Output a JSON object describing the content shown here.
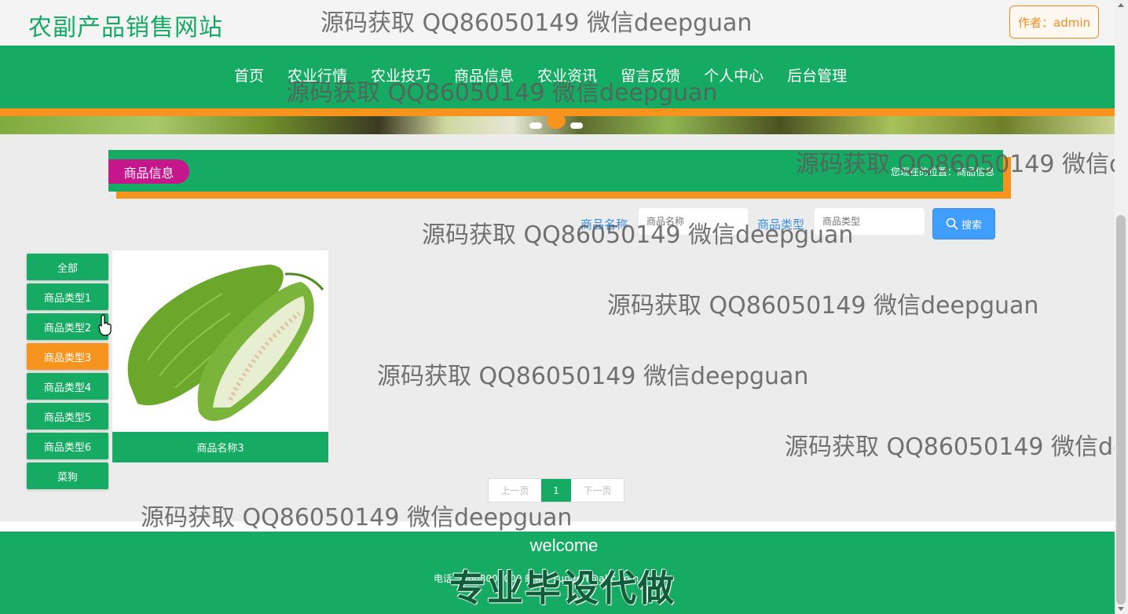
{
  "site": {
    "title": "农副产品销售网站",
    "author": "作者：admin"
  },
  "nav": {
    "items": [
      "首页",
      "农业行情",
      "农业技巧",
      "商品信息",
      "农业资讯",
      "留言反馈",
      "个人中心",
      "后台管理"
    ]
  },
  "breadcrumb": {
    "section": "商品信息",
    "location": "您现在的位置：商品信息"
  },
  "search": {
    "name_label": "商品名称",
    "name_placeholder": "商品名称",
    "type_label": "商品类型",
    "type_placeholder": "商品类型",
    "button": "搜索"
  },
  "categories": {
    "items": [
      "全部",
      "商品类型1",
      "商品类型2",
      "商品类型3",
      "商品类型4",
      "商品类型5",
      "商品类型6",
      "菜狗"
    ],
    "active": "商品类型3"
  },
  "products": [
    {
      "name": "商品名称3"
    }
  ],
  "pagination": {
    "prev": "上一页",
    "current": "1",
    "next": "下一页"
  },
  "footer": {
    "welcome": "welcome",
    "contact": "电话：4008000000  邮箱：support@abc.com",
    "banner": "专业毕设代做"
  },
  "watermark": "源码获取 QQ86050149 微信deepguan",
  "colors": {
    "primary": "#16ab63",
    "accent": "#f7941d",
    "pill": "#c5168d",
    "search": "#409eff"
  },
  "icons": [
    "search-icon",
    "hand-cursor-icon"
  ]
}
